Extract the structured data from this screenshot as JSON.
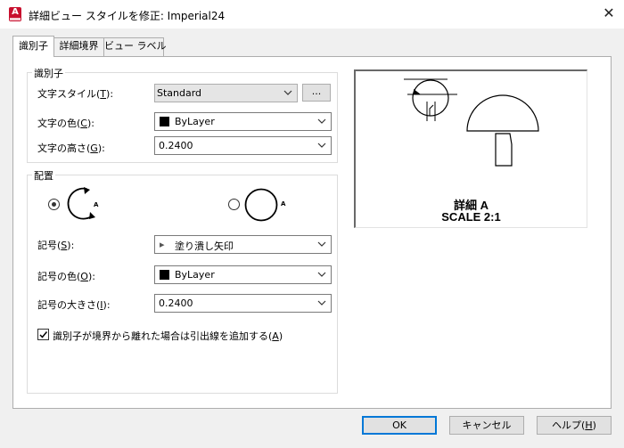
{
  "window": {
    "title": "詳細ビュー スタイルを修正: Imperial24",
    "app_icon_letter": "A",
    "close_glyph": "✕"
  },
  "tabs": [
    {
      "label": "識別子",
      "active": true
    },
    {
      "label": "詳細境界",
      "active": false
    },
    {
      "label": "ビュー ラベル",
      "active": false
    }
  ],
  "identifier": {
    "group_label": "識別子",
    "text_style": {
      "label": "文字スタイル(T):",
      "prefix": "文字スタイル(",
      "key": "T",
      "suffix": "):",
      "value": "Standard",
      "browse_label": "..."
    },
    "text_color": {
      "prefix": "文字の色(",
      "key": "C",
      "suffix": "):",
      "value": "ByLayer",
      "swatch_color": "#000000"
    },
    "text_height": {
      "prefix": "文字の高さ(",
      "key": "G",
      "suffix": "):",
      "value": "0.2400"
    }
  },
  "placement": {
    "group_label": "配置",
    "options": [
      {
        "letter": "A",
        "selected": true,
        "icon": "arrow-circle-icon"
      },
      {
        "letter": "A",
        "selected": false,
        "icon": "circle-icon"
      }
    ],
    "symbol": {
      "prefix": "記号(",
      "key": "S",
      "suffix": "):",
      "value": "塗り潰し矢印",
      "arrow_glyph": "▸"
    },
    "symbol_color": {
      "prefix": "記号の色(",
      "key": "O",
      "suffix": "):",
      "value": "ByLayer",
      "swatch_color": "#000000"
    },
    "symbol_size": {
      "prefix": "記号の大きさ(",
      "key": "I",
      "suffix": "):",
      "value": "0.2400"
    },
    "leader_checkbox": {
      "prefix": "識別子が境界から離れた場合は引出線を追加する(",
      "key": "A",
      "suffix": ")",
      "checked": true
    }
  },
  "preview": {
    "detail_label": "詳細 A",
    "scale_label": "SCALE 2:1"
  },
  "buttons": {
    "ok": "OK",
    "cancel": "キャンセル",
    "help_prefix": "ヘルプ(",
    "help_key": "H",
    "help_suffix": ")"
  }
}
